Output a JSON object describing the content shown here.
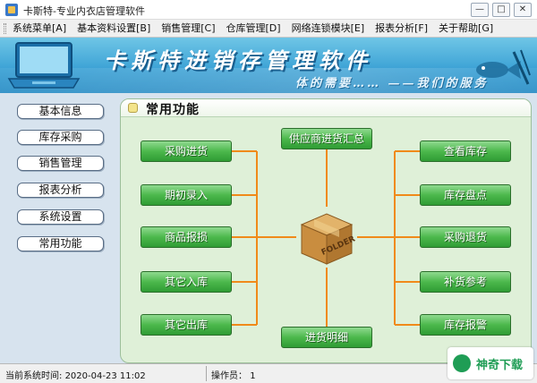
{
  "window": {
    "title": "卡斯特-专业内衣店管理软件",
    "min_label": "—",
    "max_label": "□",
    "close_label": "✕"
  },
  "menu": {
    "items": [
      {
        "label": "系统菜单[A]"
      },
      {
        "label": "基本资料设置[B]"
      },
      {
        "label": "销售管理[C]"
      },
      {
        "label": "仓库管理[D]"
      },
      {
        "label": "网络连锁模块[E]"
      },
      {
        "label": "报表分析[F]"
      },
      {
        "label": "关于帮助[G]"
      }
    ]
  },
  "banner": {
    "title": "卡斯特进销存管理软件",
    "slogan": "体的需要……  ——我们的服务"
  },
  "sidebar": {
    "items": [
      {
        "label": "基本信息"
      },
      {
        "label": "库存采购"
      },
      {
        "label": "销售管理"
      },
      {
        "label": "报表分析"
      },
      {
        "label": "系统设置"
      },
      {
        "label": "常用功能"
      }
    ]
  },
  "panel": {
    "title": "常用功能",
    "box_label": "FOLDER",
    "left_buttons": [
      {
        "label": "采购进货"
      },
      {
        "label": "期初录入"
      },
      {
        "label": "商品报损"
      },
      {
        "label": "其它入库"
      },
      {
        "label": "其它出库"
      }
    ],
    "right_buttons": [
      {
        "label": "查看库存"
      },
      {
        "label": "库存盘点"
      },
      {
        "label": "采购退货"
      },
      {
        "label": "补货参考"
      },
      {
        "label": "库存报警"
      }
    ],
    "top_button": {
      "label": "供应商进货汇总"
    },
    "bottom_button": {
      "label": "进货明细"
    }
  },
  "status": {
    "time_label": "当前系统时间:",
    "time_value": "2020-04-23 11:02",
    "operator_label": "操作员：",
    "operator_value": "1"
  },
  "watermark": {
    "text": "神奇下载"
  },
  "colors": {
    "button_green": "#3fae42",
    "connector_orange": "#f08a1a",
    "banner_blue": "#3ea3d6"
  }
}
